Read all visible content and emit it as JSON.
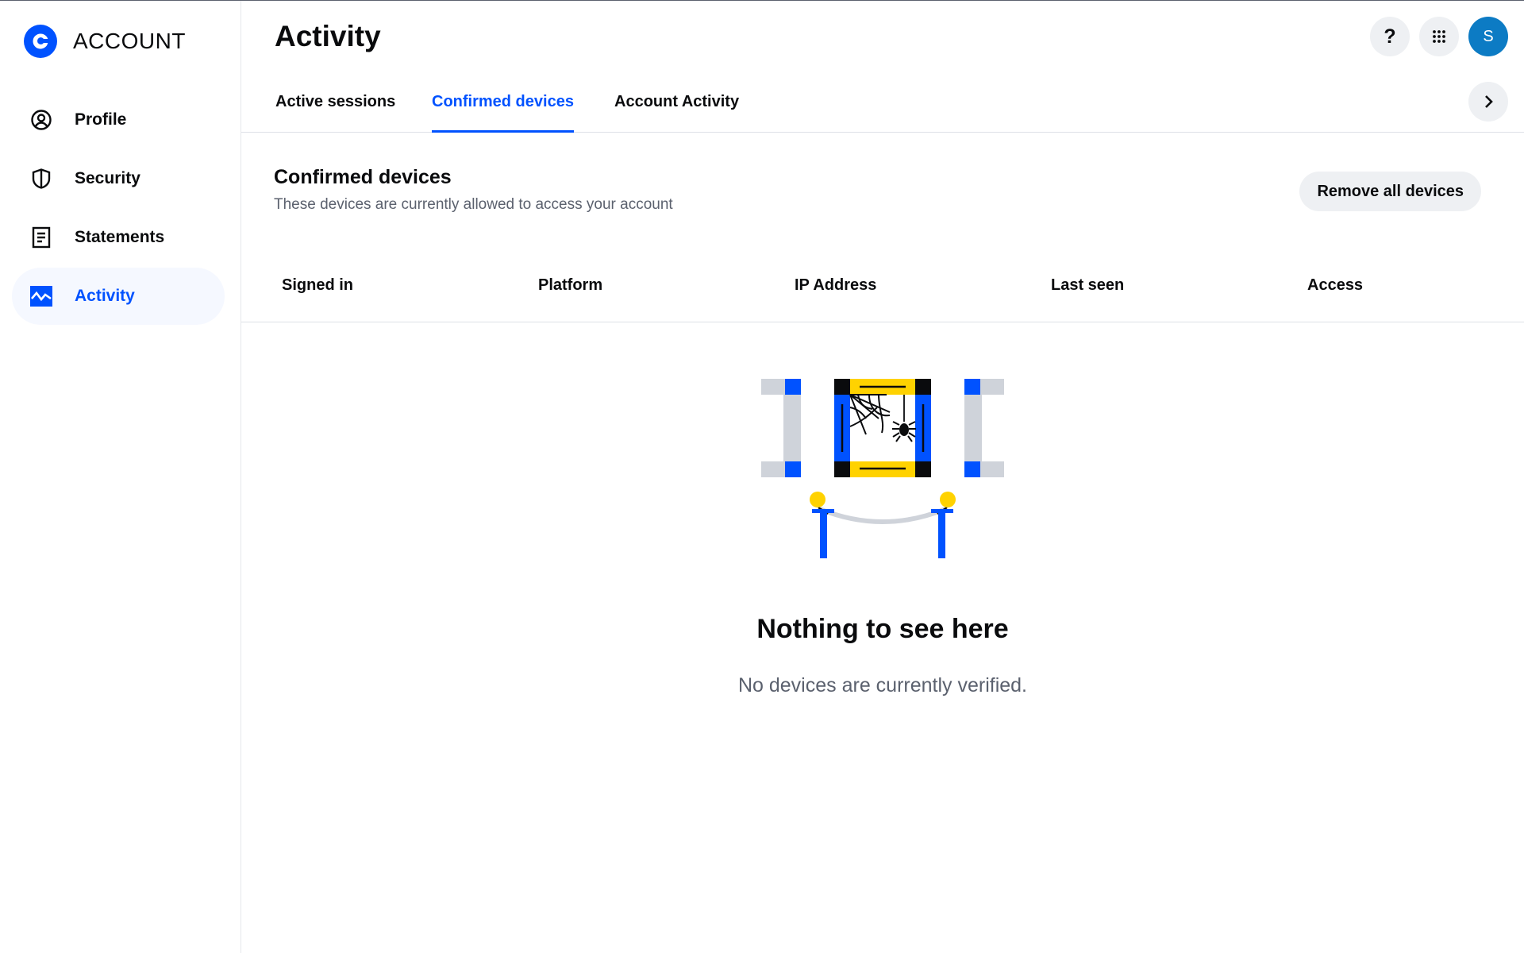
{
  "brand": {
    "name": "ACCOUNT",
    "logo_icon": "coinbase-logo-icon",
    "color": "#0052ff"
  },
  "sidebar": {
    "items": [
      {
        "label": "Profile",
        "icon": "user-circle-icon",
        "active": false
      },
      {
        "label": "Security",
        "icon": "shield-icon",
        "active": false
      },
      {
        "label": "Statements",
        "icon": "document-icon",
        "active": false
      },
      {
        "label": "Activity",
        "icon": "activity-chart-icon",
        "active": true
      }
    ]
  },
  "header": {
    "title": "Activity",
    "help_label": "?",
    "avatar_initial": "S",
    "avatar_color": "#0c7bc4"
  },
  "tabs": [
    {
      "label": "Active sessions",
      "active": false
    },
    {
      "label": "Confirmed devices",
      "active": true
    },
    {
      "label": "Account Activity",
      "active": false
    }
  ],
  "section": {
    "title": "Confirmed devices",
    "subtitle": "These devices are currently allowed to access your account",
    "remove_all_label": "Remove all devices"
  },
  "table": {
    "columns": [
      "Signed in",
      "Platform",
      "IP Address",
      "Last seen",
      "Access"
    ],
    "rows": []
  },
  "empty_state": {
    "illustration": "empty-gallery-spiderweb-illustration",
    "title": "Nothing to see here",
    "message": "No devices are currently verified."
  },
  "colors": {
    "accent": "#0052ff",
    "active_bg": "#f5f8ff",
    "button_bg": "#eef0f3",
    "muted_text": "#5b616e",
    "illustration_yellow": "#ffd200"
  }
}
